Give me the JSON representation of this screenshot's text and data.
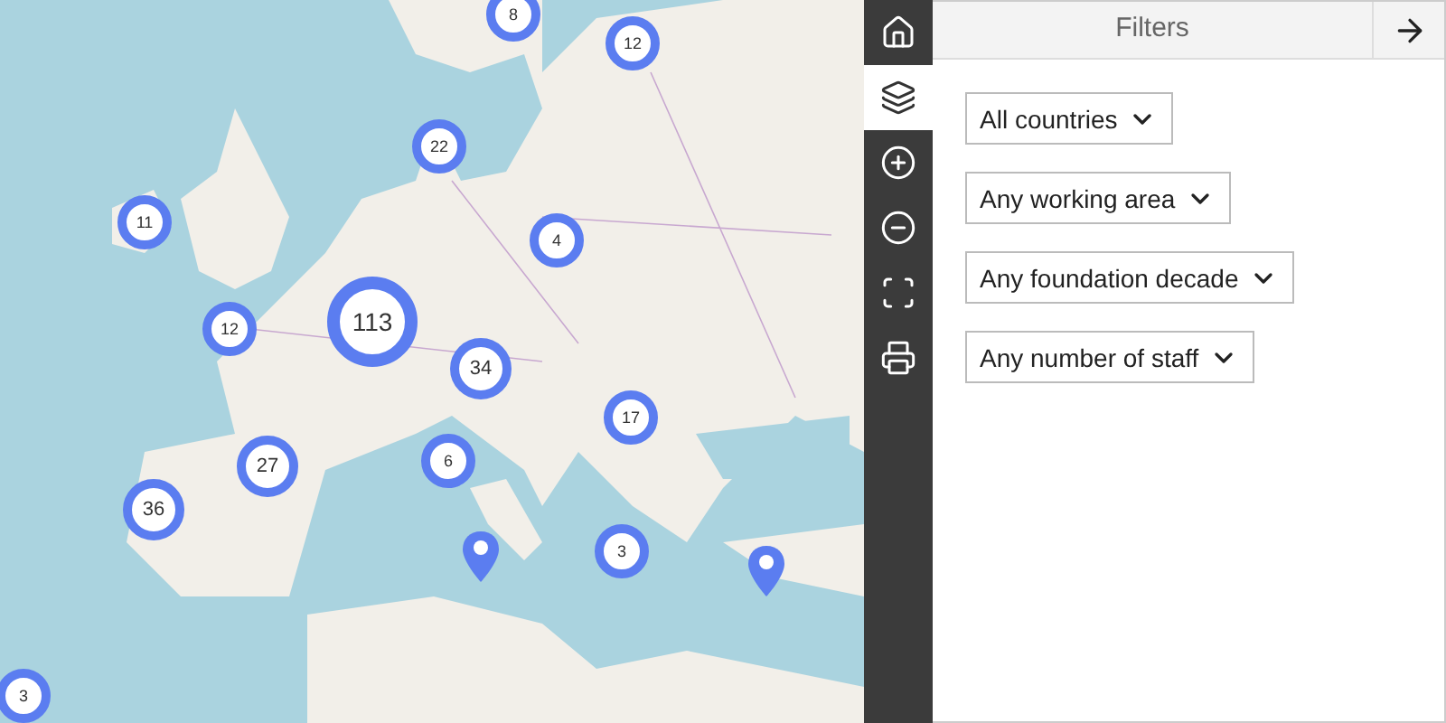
{
  "map": {
    "kind": "picture",
    "markers": [
      {
        "kind": "cluster",
        "count": "8"
      },
      {
        "kind": "cluster",
        "count": "12"
      },
      {
        "kind": "cluster",
        "count": "22"
      },
      {
        "kind": "cluster",
        "count": "11"
      },
      {
        "kind": "cluster",
        "count": "4"
      },
      {
        "kind": "cluster",
        "count": "12"
      },
      {
        "kind": "cluster",
        "count": "113"
      },
      {
        "kind": "cluster",
        "count": "34"
      },
      {
        "kind": "cluster",
        "count": "17"
      },
      {
        "kind": "cluster",
        "count": "27"
      },
      {
        "kind": "cluster",
        "count": "6"
      },
      {
        "kind": "cluster",
        "count": "36"
      },
      {
        "kind": "cluster",
        "count": "3"
      },
      {
        "kind": "cluster",
        "count": "3"
      },
      {
        "kind": "pin"
      },
      {
        "kind": "pin"
      }
    ]
  },
  "toolbar": [
    {
      "kind": "home",
      "selected": false
    },
    {
      "kind": "layers",
      "selected": true
    },
    {
      "kind": "zoom-in",
      "selected": false
    },
    {
      "kind": "zoom-out",
      "selected": false
    },
    {
      "kind": "fullscreen",
      "selected": false
    },
    {
      "kind": "print",
      "selected": false
    }
  ],
  "panel": {
    "title": "Filters",
    "filters": [
      {
        "value": "All countries"
      },
      {
        "value": "Any working area"
      },
      {
        "value": "Any foundation decade"
      },
      {
        "value": "Any number of staff"
      }
    ]
  }
}
